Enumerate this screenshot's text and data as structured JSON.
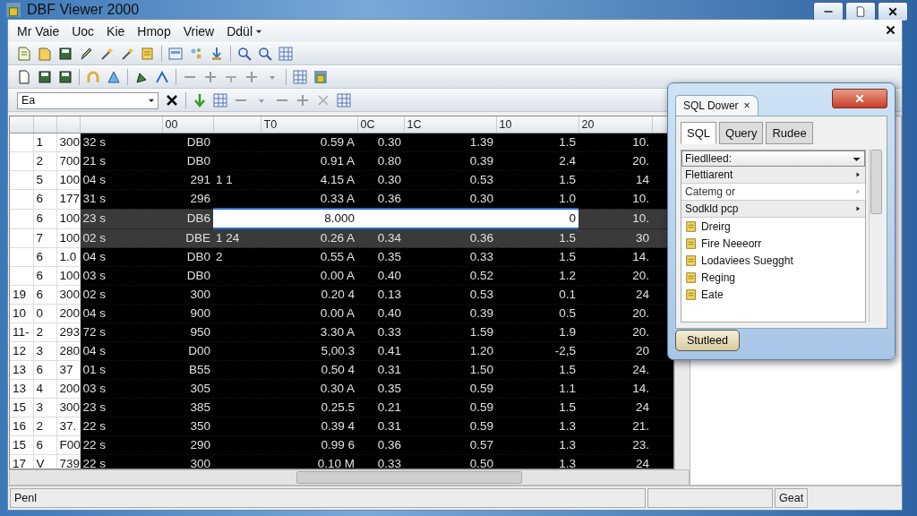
{
  "window": {
    "title": "DBF Viewer 2000"
  },
  "menu": [
    {
      "label": "Mr Vaie",
      "dropdown": false
    },
    {
      "label": "Uoc",
      "dropdown": false
    },
    {
      "label": "Kie",
      "dropdown": false
    },
    {
      "label": "Hmop",
      "dropdown": false
    },
    {
      "label": "Vriew",
      "dropdown": false
    },
    {
      "label": "Ddül",
      "dropdown": true
    }
  ],
  "filter_combo": {
    "value": "Ea"
  },
  "table": {
    "columns": [
      {},
      {},
      {},
      {},
      {
        "label": "00"
      },
      {},
      {
        "label": "T0"
      },
      {
        "label": "0C"
      },
      {
        "label": "1C"
      },
      {
        "label": "10"
      },
      {
        "label": "20"
      }
    ],
    "rows": [
      {
        "cells": [
          "",
          "1",
          "300",
          "32 s",
          "DB0",
          "",
          "0.59 A",
          "0.30",
          "1.39",
          "1.5",
          "10."
        ],
        "selected": false,
        "editing": false
      },
      {
        "cells": [
          "",
          "2",
          "700",
          "21 s",
          "DB0",
          "",
          "0.91 A",
          "0.80",
          "0.39",
          "2.4",
          "20."
        ],
        "selected": false,
        "editing": false
      },
      {
        "cells": [
          "",
          "5",
          "100",
          "04 s",
          "291",
          "1 1",
          "4.15 A",
          "0.30",
          "0.53",
          "1.5",
          "14"
        ],
        "selected": false,
        "editing": false
      },
      {
        "cells": [
          "",
          "6",
          "177",
          "31 s",
          "296",
          "",
          "0.33 A",
          "0.36",
          "0.30",
          "1.0",
          "10."
        ],
        "selected": false,
        "editing": false
      },
      {
        "cells": [
          "",
          "6",
          "100",
          "23 s",
          "DB6",
          "",
          "8.000",
          "",
          "",
          "0",
          "10."
        ],
        "selected": true,
        "editing": true
      },
      {
        "cells": [
          "",
          "7",
          "100",
          "02 s",
          "DBE",
          "1 24",
          "0.26 A",
          "0.34",
          "0.36",
          "1.5",
          "30"
        ],
        "selected": true,
        "editing": false
      },
      {
        "cells": [
          "",
          "6",
          "1.0",
          "04 s",
          "DB0",
          "2",
          "0.55 A",
          "0.35",
          "0.33",
          "1.5",
          "14."
        ],
        "selected": false,
        "editing": false
      },
      {
        "cells": [
          "",
          "6",
          "100",
          "03 s",
          "DB0",
          "",
          "0.00 A",
          "0.40",
          "0.52",
          "1.2",
          "20."
        ],
        "selected": false,
        "editing": false
      },
      {
        "cells": [
          "19",
          "6",
          "300",
          "02 s",
          "300",
          "",
          "0.20 4",
          "0.13",
          "0.53",
          "0.1",
          "24"
        ],
        "selected": false,
        "editing": false
      },
      {
        "cells": [
          "10",
          "0",
          "200",
          "04 s",
          "900",
          "",
          "0.00 A",
          "0.40",
          "0.39",
          "0.5",
          "20."
        ],
        "selected": false,
        "editing": false
      },
      {
        "cells": [
          "11-",
          "2",
          "293",
          "72 s",
          "950",
          "",
          "3.30 A",
          "0.33",
          "1.59",
          "1.9",
          "20."
        ],
        "selected": false,
        "editing": false
      },
      {
        "cells": [
          "12",
          "3",
          "280",
          "04 s",
          "D00",
          "",
          "5,00.3",
          "0.41",
          "1.20",
          "-2,5",
          "20"
        ],
        "selected": false,
        "editing": false
      },
      {
        "cells": [
          "13",
          "6",
          "37",
          "01 s",
          "B55",
          "",
          "0.50 4",
          "0.31",
          "1.50",
          "1.5",
          "24."
        ],
        "selected": false,
        "editing": false
      },
      {
        "cells": [
          "13",
          "4",
          "200",
          "03 s",
          "305",
          "",
          "0.30 A",
          "0.35",
          "0.59",
          "1.1",
          "14."
        ],
        "selected": false,
        "editing": false
      },
      {
        "cells": [
          "15",
          "3",
          "300",
          "23 s",
          "385",
          "",
          "0.25.5",
          "0.21",
          "0.59",
          "1.5",
          "24"
        ],
        "selected": false,
        "editing": false
      },
      {
        "cells": [
          "16",
          "2",
          "37.",
          "22 s",
          "350",
          "",
          "0.39 4",
          "0.31",
          "0.59",
          "1.3",
          "21."
        ],
        "selected": false,
        "editing": false
      },
      {
        "cells": [
          "15",
          "6",
          "F00",
          "22 s",
          "290",
          "",
          "0.99 6",
          "0.36",
          "0.57",
          "1.3",
          "23."
        ],
        "selected": false,
        "editing": false
      },
      {
        "cells": [
          "17",
          "V",
          "739",
          "22 s",
          "300",
          "",
          "0.10 M",
          "0.33",
          "0.50",
          "1.3",
          "24"
        ],
        "selected": false,
        "editing": false
      }
    ]
  },
  "sql_dialog": {
    "tab_title": "SQL Dower",
    "tab_close": "×",
    "tabs": [
      {
        "label": "SQL",
        "selected": true
      },
      {
        "label": "Query",
        "selected": false
      },
      {
        "label": "Rudee",
        "selected": false
      }
    ],
    "combo": {
      "value": "Fiedlleed:"
    },
    "items": [
      {
        "kind": "submenu",
        "label": "Flettiarent",
        "disabled": false
      },
      {
        "kind": "submenu",
        "label": "Catemg or",
        "disabled": true
      },
      {
        "kind": "submenu",
        "label": "Sodkld pcp",
        "disabled": false
      },
      {
        "kind": "item",
        "label": "Dreirg",
        "disabled": false
      },
      {
        "kind": "item",
        "label": "Fire Neeeorr",
        "disabled": false
      },
      {
        "kind": "item",
        "label": "Lodaviees Suegght",
        "disabled": false
      },
      {
        "kind": "item",
        "label": "Reging",
        "disabled": false
      },
      {
        "kind": "item",
        "label": "Eate",
        "disabled": false
      }
    ],
    "button": "Stutleed"
  },
  "status_bar": {
    "left": "Penl",
    "right": "Geat"
  }
}
